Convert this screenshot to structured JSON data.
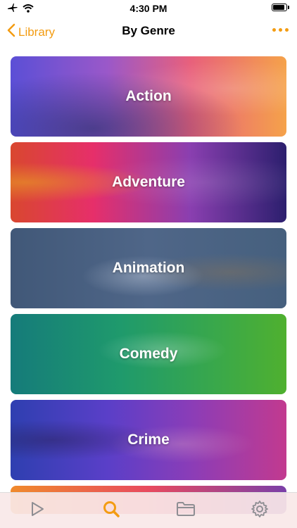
{
  "status_bar": {
    "time": "4:30 PM",
    "icons": [
      "airplane-icon",
      "wifi-icon",
      "battery-icon"
    ]
  },
  "nav": {
    "back_label": "Library",
    "title": "By Genre",
    "more_icon": "ellipsis-icon"
  },
  "genres": [
    {
      "label": "Action"
    },
    {
      "label": "Adventure"
    },
    {
      "label": "Animation"
    },
    {
      "label": "Comedy"
    },
    {
      "label": "Crime"
    }
  ],
  "tabs": [
    {
      "icon": "play-icon",
      "selected": false
    },
    {
      "icon": "search-icon",
      "selected": true
    },
    {
      "icon": "folder-icon",
      "selected": false
    },
    {
      "icon": "gear-icon",
      "selected": false
    }
  ],
  "colors": {
    "accent": "#F39C12",
    "inactive_tab": "#8e8e93"
  }
}
